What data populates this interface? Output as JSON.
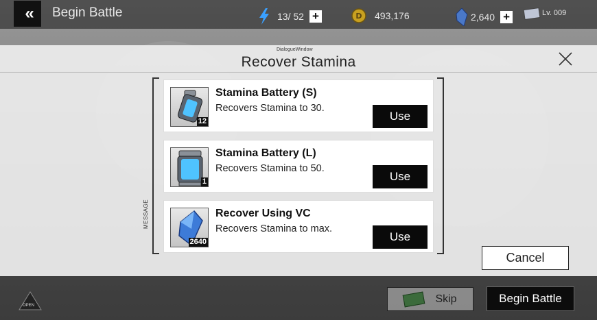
{
  "header": {
    "title": "Begin Battle",
    "stamina": "13/ 52",
    "coins": "493,176",
    "vc": "2,640",
    "level": "Lv. 009"
  },
  "dialog": {
    "window_tag": "DialogueWindow",
    "title": "Recover Stamina",
    "message_label": "MESSAGE",
    "items": [
      {
        "name": "Stamina Battery (S)",
        "desc": "Recovers Stamina to 30.",
        "count": "12",
        "button": "Use",
        "icon": "stamina-battery-small-icon"
      },
      {
        "name": "Stamina Battery (L)",
        "desc": "Recovers Stamina to 50.",
        "count": "1",
        "button": "Use",
        "icon": "stamina-battery-large-icon"
      },
      {
        "name": "Recover Using VC",
        "desc": "Recovers Stamina to max.",
        "count": "2640",
        "button": "Use",
        "icon": "vc-crystal-icon"
      }
    ],
    "cancel": "Cancel"
  },
  "footer": {
    "open": "OPEN",
    "skip": "Skip",
    "begin_battle": "Begin Battle"
  },
  "colors": {
    "accent_dark": "#0a0a0a",
    "dialog_bg": "#f0f0f0",
    "stamina_blue": "#3aa0ff"
  }
}
